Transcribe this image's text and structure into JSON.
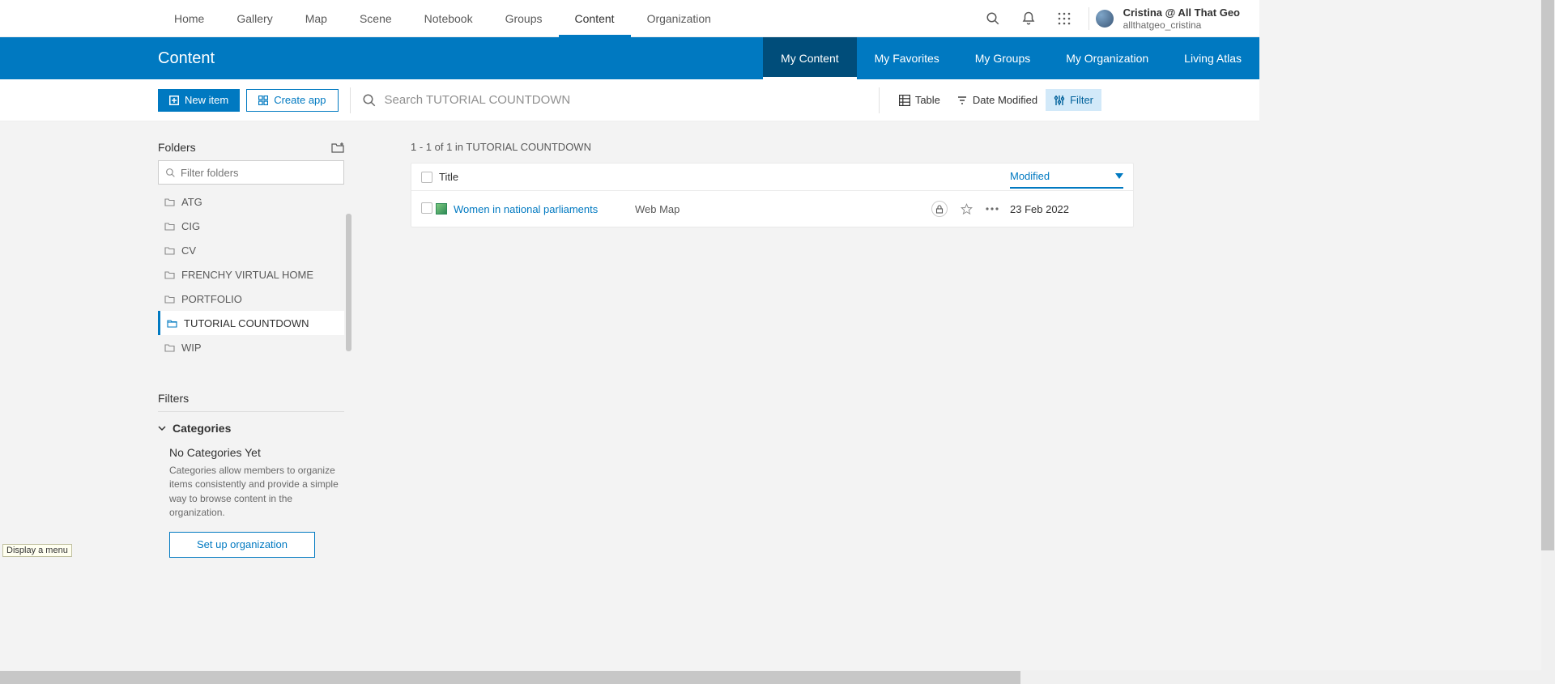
{
  "topnav": {
    "items": [
      "Home",
      "Gallery",
      "Map",
      "Scene",
      "Notebook",
      "Groups",
      "Content",
      "Organization"
    ],
    "active": "Content"
  },
  "user": {
    "display": "Cristina @ All That Geo",
    "handle": "allthatgeo_cristina"
  },
  "subnav": {
    "title": "Content",
    "tabs": [
      "My Content",
      "My Favorites",
      "My Groups",
      "My Organization",
      "Living Atlas"
    ],
    "active": "My Content"
  },
  "toolbar": {
    "new_item": "New item",
    "create_app": "Create app",
    "search_placeholder": "Search TUTORIAL COUNTDOWN",
    "table": "Table",
    "date_modified": "Date Modified",
    "filter": "Filter"
  },
  "folders": {
    "header": "Folders",
    "search_placeholder": "Filter folders",
    "items": [
      "ATG",
      "CIG",
      "CV",
      "FRENCHY VIRTUAL HOME",
      "PORTFOLIO",
      "TUTORIAL COUNTDOWN",
      "WIP"
    ],
    "selected": "TUTORIAL COUNTDOWN"
  },
  "filters": {
    "header": "Filters",
    "categories_label": "Categories",
    "nocat_title": "No Categories Yet",
    "nocat_desc": "Categories allow members to organize items consistently and provide a simple way to browse content in the organization.",
    "setup": "Set up organization"
  },
  "results": {
    "count_line": "1 - 1 of 1 in TUTORIAL COUNTDOWN",
    "columns": {
      "title": "Title",
      "modified": "Modified"
    },
    "rows": [
      {
        "title": "Women in national parliaments",
        "type": "Web Map",
        "modified": "23 Feb 2022"
      }
    ]
  },
  "tooltip": "Display a menu"
}
